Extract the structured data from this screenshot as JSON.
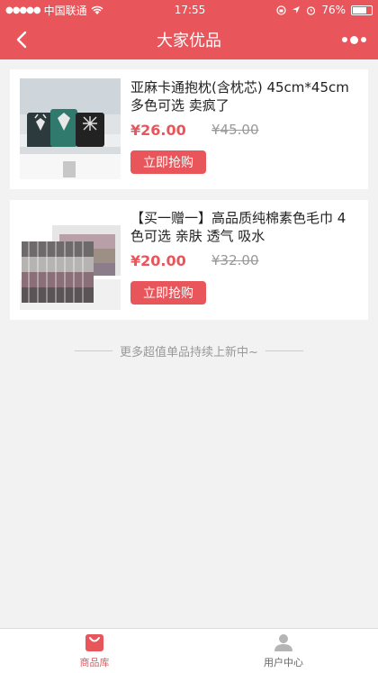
{
  "status": {
    "carrier": "中国联通",
    "time": "17:55",
    "battery": "76%",
    "battery_level": 0.76
  },
  "nav": {
    "title": "大家优品"
  },
  "products": [
    {
      "name": "亚麻卡通抱枕(含枕芯) 45cm*45cm 多色可选 卖疯了",
      "price": "¥26.00",
      "old_price": "¥45.00",
      "buy_label": "立即抢购"
    },
    {
      "name": "【买一赠一】高品质纯棉素色毛巾 4色可选 亲肤 透气 吸水",
      "price": "¥20.00",
      "old_price": "¥32.00",
      "buy_label": "立即抢购"
    }
  ],
  "more_hint": "更多超值单品持续上新中~",
  "tabs": [
    {
      "label": "商品库",
      "active": true
    },
    {
      "label": "用户中心",
      "active": false
    }
  ],
  "colors": {
    "accent": "#e8555a"
  }
}
